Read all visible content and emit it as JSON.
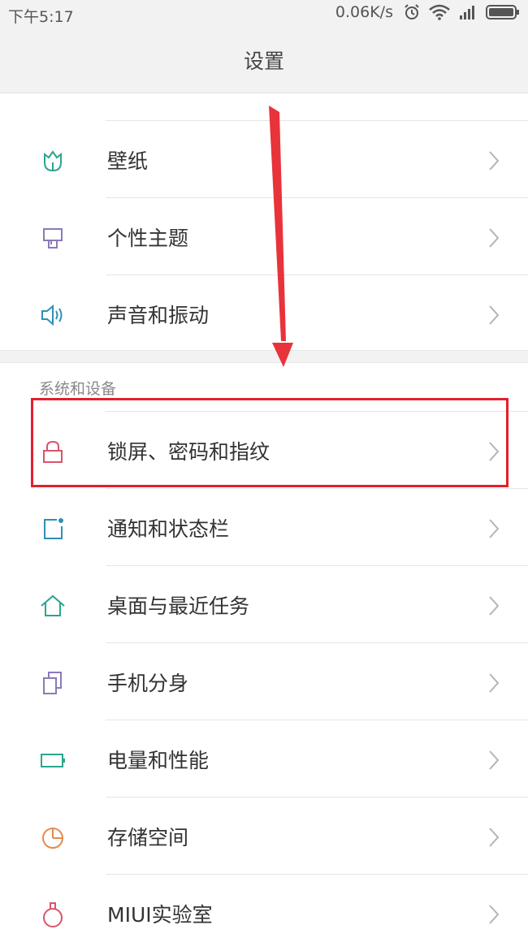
{
  "status_bar": {
    "time": "下午5:17",
    "net_speed": "0.06K/s",
    "icons": [
      "alarm-icon",
      "wifi-icon",
      "signal-icon",
      "battery-icon"
    ]
  },
  "header": {
    "title": "设置"
  },
  "top_group": [
    {
      "label": "壁纸",
      "icon": "wallpaper-icon"
    },
    {
      "label": "个性主题",
      "icon": "theme-icon"
    },
    {
      "label": "声音和振动",
      "icon": "sound-icon"
    }
  ],
  "section": {
    "title": "系统和设备"
  },
  "system_group": [
    {
      "label": "锁屏、密码和指纹",
      "icon": "lock-icon"
    },
    {
      "label": "通知和状态栏",
      "icon": "notification-icon"
    },
    {
      "label": "桌面与最近任务",
      "icon": "home-icon"
    },
    {
      "label": "手机分身",
      "icon": "second-space-icon"
    },
    {
      "label": "电量和性能",
      "icon": "battery-icon"
    },
    {
      "label": "存储空间",
      "icon": "storage-icon"
    },
    {
      "label": "MIUI实验室",
      "icon": "lab-icon"
    }
  ],
  "colors": {
    "highlight": "#e2202b",
    "arrow": "#e8333b",
    "background": "#f2f2f2"
  }
}
